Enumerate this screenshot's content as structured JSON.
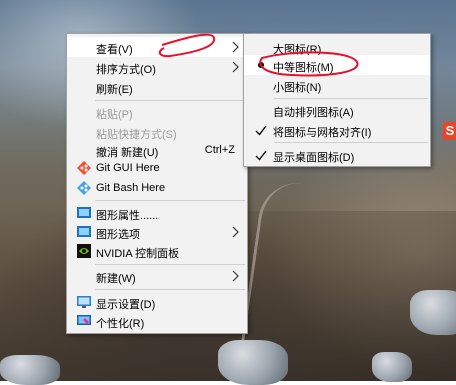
{
  "context_menu": {
    "items": [
      {
        "label": "查看(V)"
      },
      {
        "label": "排序方式(O)"
      },
      {
        "label": "刷新(E)"
      },
      {
        "label": "粘贴(P)"
      },
      {
        "label": "粘贴快捷方式(S)"
      },
      {
        "label": "撤消 新建(U)",
        "shortcut": "Ctrl+Z"
      },
      {
        "label": "Git GUI Here",
        "icon": "git-gui-icon"
      },
      {
        "label": "Git Bash Here",
        "icon": "git-bash-icon"
      },
      {
        "label": "图形属性......",
        "icon": "intel-graphics-icon"
      },
      {
        "label": "图形选项",
        "icon": "intel-graphics-icon"
      },
      {
        "label": "NVIDIA 控制面板",
        "icon": "nvidia-icon"
      },
      {
        "label": "新建(W)"
      },
      {
        "label": "显示设置(D)",
        "icon": "display-settings-icon"
      },
      {
        "label": "个性化(R)",
        "icon": "personalize-icon"
      }
    ]
  },
  "view_submenu": {
    "items": [
      {
        "label": "大图标(R)"
      },
      {
        "label": "中等图标(M)"
      },
      {
        "label": "小图标(N)"
      },
      {
        "label": "自动排列图标(A)"
      },
      {
        "label": "将图标与网格对齐(I)"
      },
      {
        "label": "显示桌面图标(D)"
      }
    ]
  },
  "colors": {
    "menu_bg": "#f2f2f2",
    "highlight_bg": "#ffffff",
    "disabled_text": "#9a9a9a",
    "annotation_red": "#e8102a",
    "git_gui": "#f05133",
    "nvidia_green": "#76b900",
    "intel_blue": "#1e73be"
  }
}
